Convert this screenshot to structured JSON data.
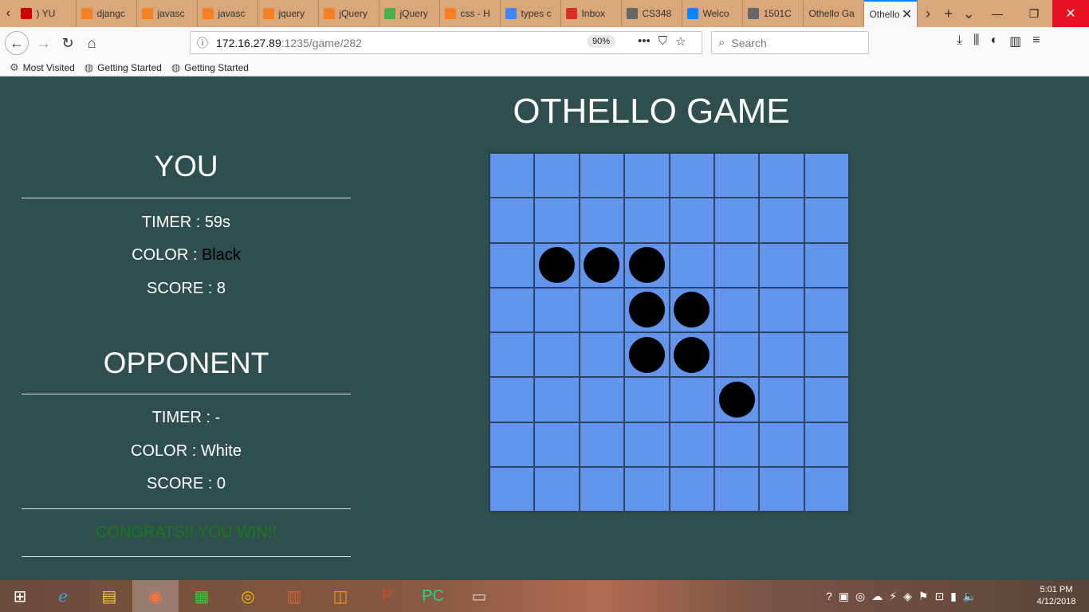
{
  "browser": {
    "tabs": [
      {
        "label": ") YU",
        "icon": "youtube-icon",
        "color": "#cc0000"
      },
      {
        "label": "djangc",
        "icon": "stackoverflow-icon",
        "color": "#f48024"
      },
      {
        "label": "javasc",
        "icon": "stackoverflow-icon",
        "color": "#f48024"
      },
      {
        "label": "javasc",
        "icon": "stackoverflow-icon",
        "color": "#f48024"
      },
      {
        "label": "jquery",
        "icon": "stackoverflow-icon",
        "color": "#f48024"
      },
      {
        "label": "jQuery",
        "icon": "stackoverflow-icon",
        "color": "#f48024"
      },
      {
        "label": "jQuery",
        "icon": "w3schools-icon",
        "color": "#4caf50"
      },
      {
        "label": "css - H",
        "icon": "stackoverflow-icon",
        "color": "#f48024"
      },
      {
        "label": "types c",
        "icon": "google-icon",
        "color": "#4285f4"
      },
      {
        "label": "Inbox",
        "icon": "gmail-icon",
        "color": "#d93025"
      },
      {
        "label": "CS348",
        "icon": "gear-icon",
        "color": "#666666"
      },
      {
        "label": "Welco",
        "icon": "dot-icon",
        "color": "#0a84ff"
      },
      {
        "label": "1501C",
        "icon": "gear-icon",
        "color": "#666666"
      },
      {
        "label": "Othello Ga",
        "icon": "",
        "color": ""
      }
    ],
    "active_tab": {
      "label": "Othello"
    },
    "url_host": "172.16.27.89",
    "url_path": ":1235/game/282",
    "zoom": "90%",
    "search_placeholder": "Search",
    "bookmarks": [
      {
        "label": "Most Visited",
        "icon": "gear-icon"
      },
      {
        "label": "Getting Started",
        "icon": "globe-icon"
      },
      {
        "label": "Getting Started",
        "icon": "globe-icon"
      }
    ]
  },
  "game": {
    "title": "OTHELLO GAME",
    "you": {
      "heading": "YOU",
      "timer_label": "TIMER : ",
      "timer": "59s",
      "color_label": "COLOR : ",
      "color": "Black",
      "score_label": "SCORE : ",
      "score": "8"
    },
    "opponent": {
      "heading": "OPPONENT",
      "timer_label": "TIMER : ",
      "timer": "-",
      "color_label": "COLOR : ",
      "color": "White",
      "score_label": "SCORE : ",
      "score": "0"
    },
    "result": "CONGRATS!! YOU WIN!!",
    "board": [
      [
        0,
        0,
        0,
        0,
        0,
        0,
        0,
        0
      ],
      [
        0,
        0,
        0,
        0,
        0,
        0,
        0,
        0
      ],
      [
        0,
        1,
        1,
        1,
        0,
        0,
        0,
        0
      ],
      [
        0,
        0,
        0,
        1,
        1,
        0,
        0,
        0
      ],
      [
        0,
        0,
        0,
        1,
        1,
        0,
        0,
        0
      ],
      [
        0,
        0,
        0,
        0,
        0,
        1,
        0,
        0
      ],
      [
        0,
        0,
        0,
        0,
        0,
        0,
        0,
        0
      ],
      [
        0,
        0,
        0,
        0,
        0,
        0,
        0,
        0
      ]
    ],
    "colors": {
      "background": "#2f4f4f",
      "board": "#6495ed",
      "black": "#000000",
      "white": "#ffffff",
      "win_text": "#1a7a1a"
    }
  },
  "taskbar": {
    "clock_time": "5:01 PM",
    "clock_date": "4/12/2018",
    "apps": [
      "windows-start-icon",
      "internet-explorer-icon",
      "file-explorer-icon",
      "firefox-icon",
      "store-icon",
      "chrome-icon",
      "winrar-icon",
      "pdf-icon",
      "powerpoint-icon",
      "pycharm-icon",
      "terminal-icon"
    ]
  }
}
